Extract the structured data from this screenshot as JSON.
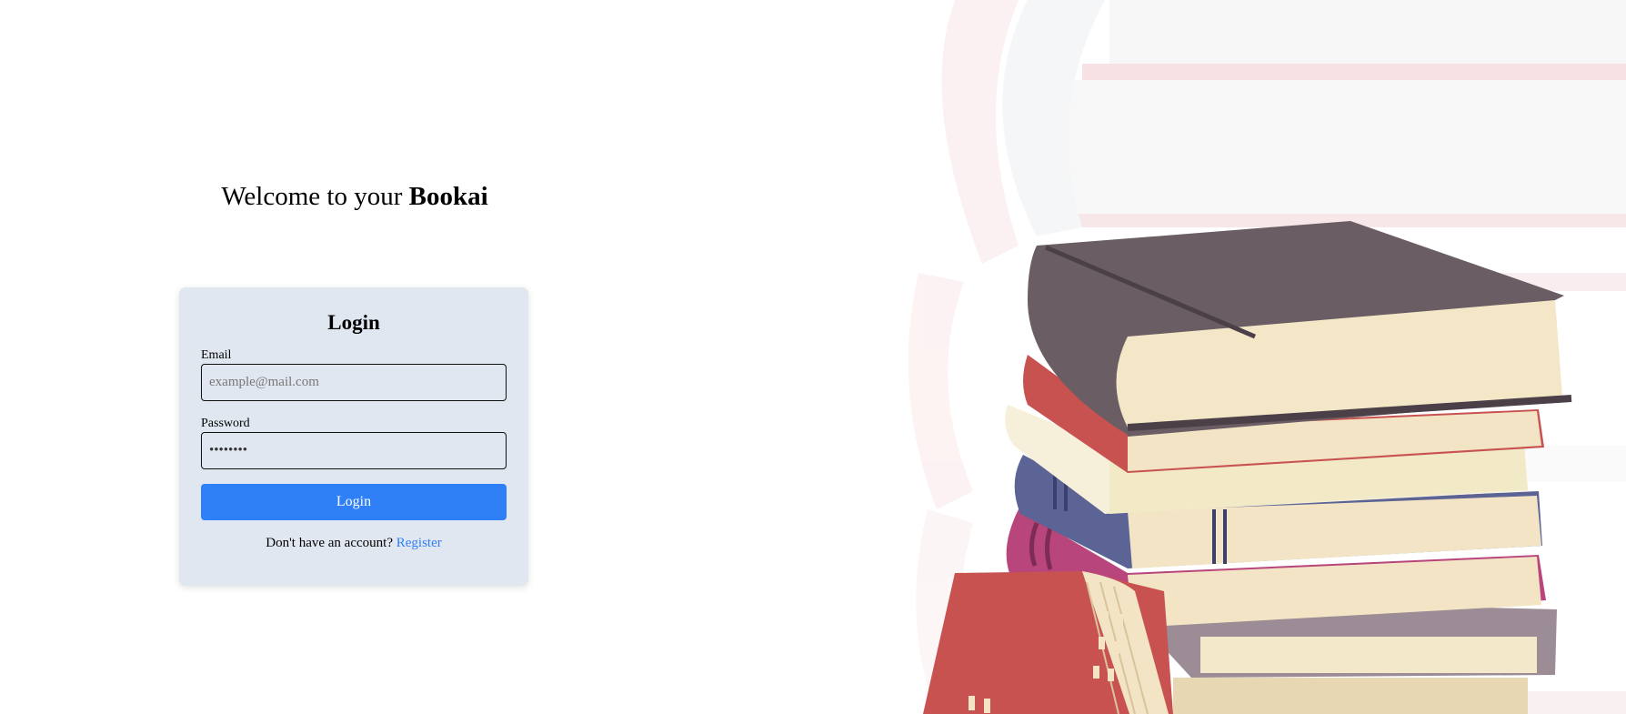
{
  "header": {
    "welcome_prefix": "Welcome to your ",
    "brand_name": "Bookai"
  },
  "login_form": {
    "title": "Login",
    "email_label": "Email",
    "email_placeholder": "example@mail.com",
    "email_value": "",
    "password_label": "Password",
    "password_value": "password",
    "submit_label": "Login"
  },
  "register": {
    "prompt": "Don't have an account?",
    "link_label": "Register"
  },
  "illustration": {
    "icon": "book-stack-illustration"
  },
  "colors": {
    "card_background": "#e1e7f0",
    "accent": "#2f7ff7",
    "page_background": "#ffffff"
  }
}
